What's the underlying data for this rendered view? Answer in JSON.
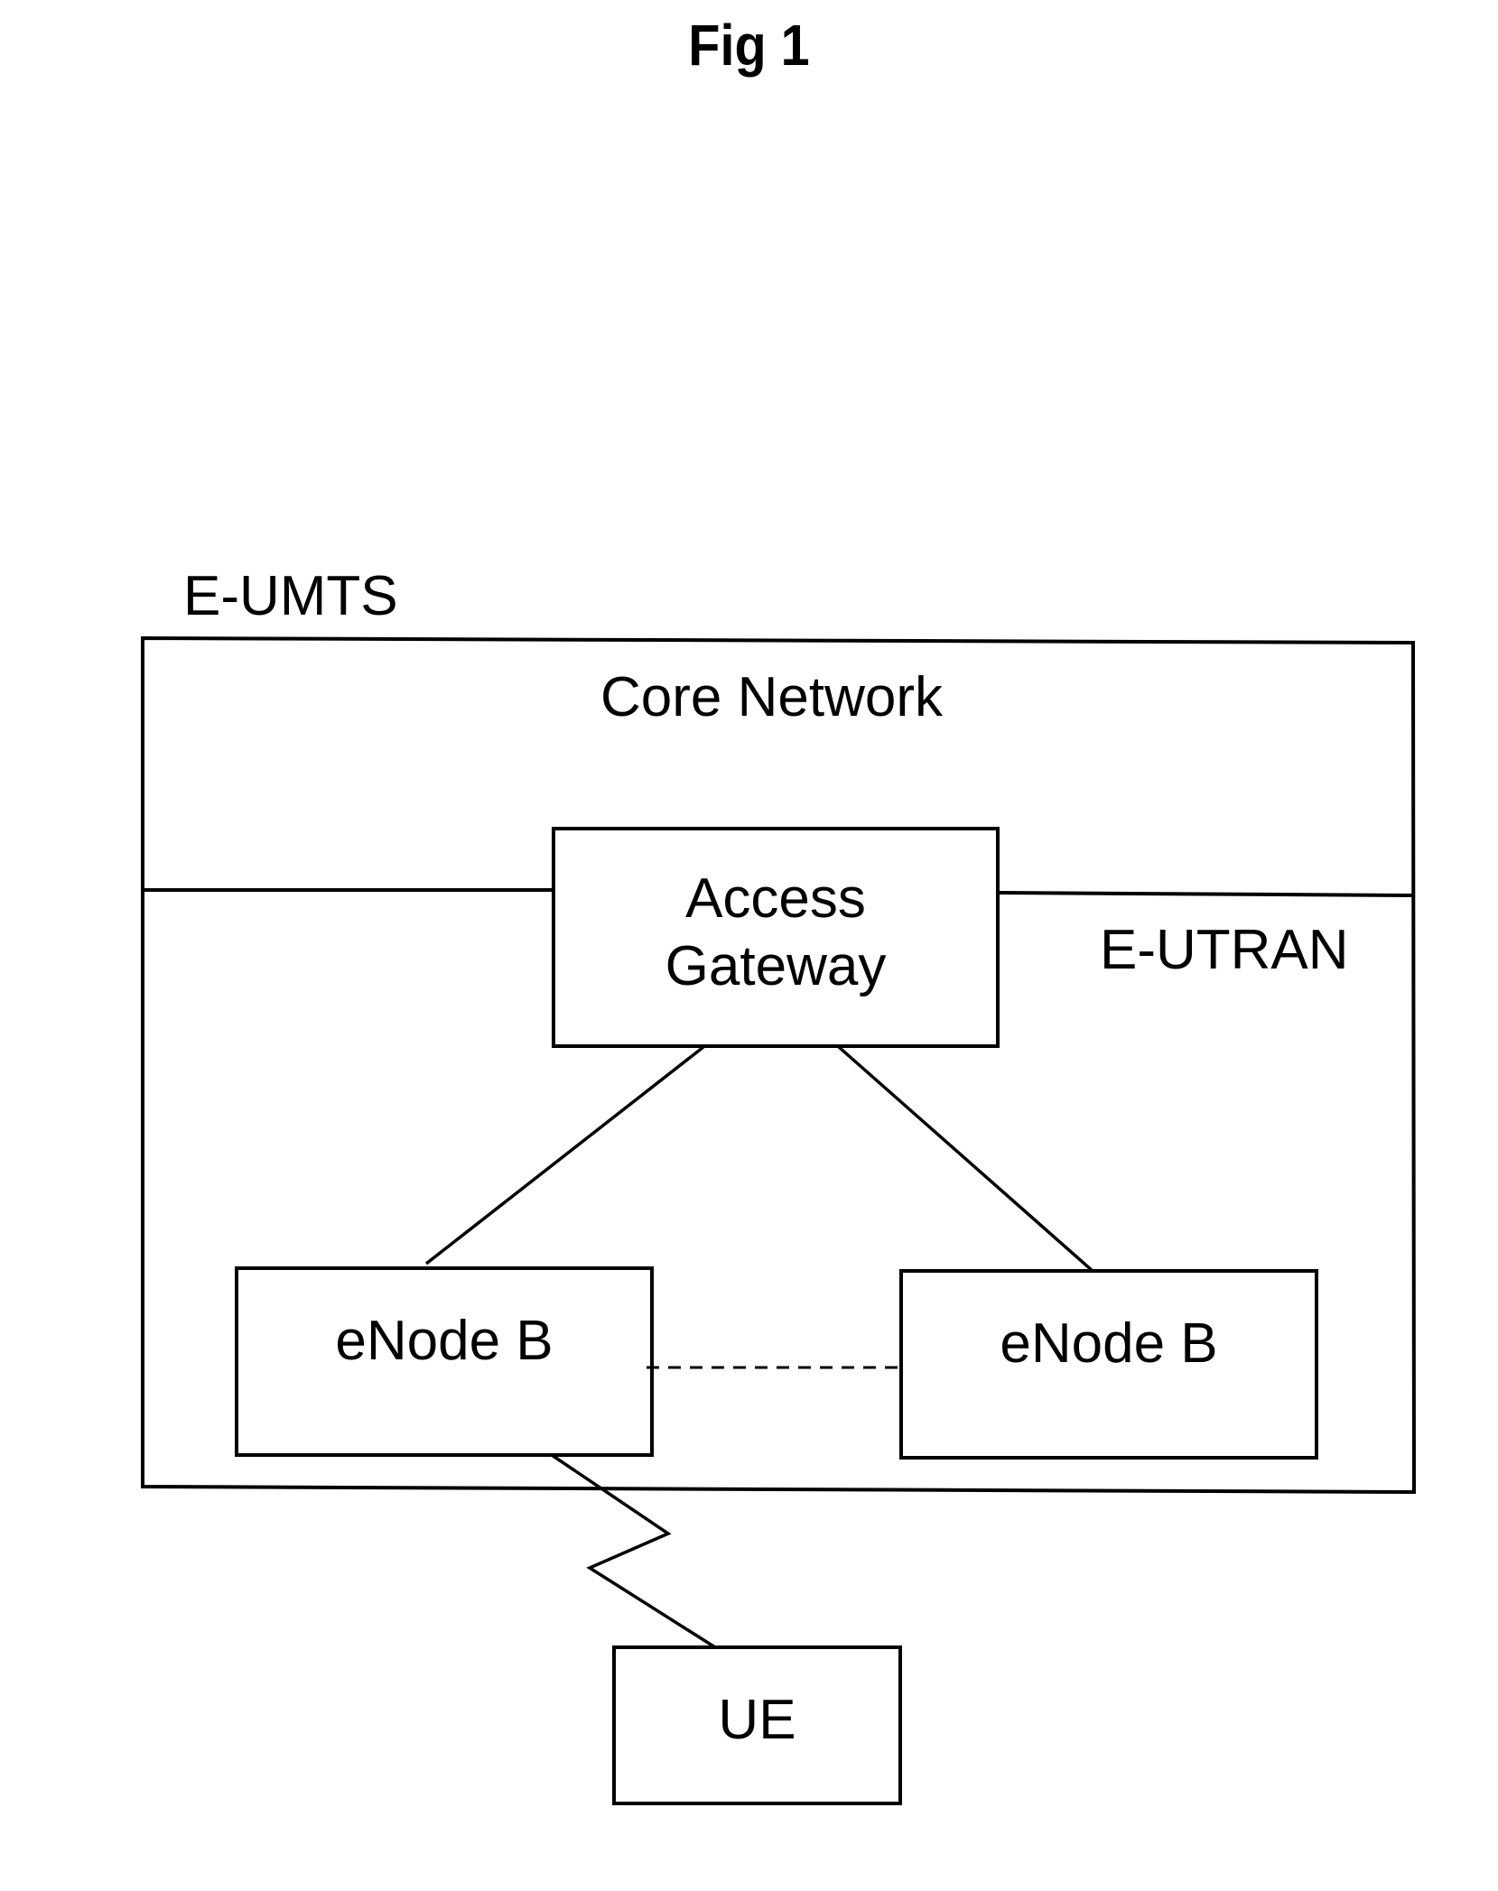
{
  "figure": {
    "title": "Fig 1"
  },
  "diagram": {
    "system_label": "E-UMTS",
    "core_network_label": "Core Network",
    "eutran_label": "E-UTRAN",
    "nodes": {
      "access_gateway": {
        "line1": "Access",
        "line2": "Gateway"
      },
      "enodeb_left": "eNode B",
      "enodeb_right": "eNode B",
      "ue": "UE"
    },
    "connections": [
      {
        "from": "access_gateway",
        "to": "enodeb_left",
        "style": "solid"
      },
      {
        "from": "access_gateway",
        "to": "enodeb_right",
        "style": "solid"
      },
      {
        "from": "enodeb_left",
        "to": "enodeb_right",
        "style": "dashed"
      },
      {
        "from": "enodeb_left",
        "to": "ue",
        "style": "radio-zigzag"
      }
    ]
  }
}
